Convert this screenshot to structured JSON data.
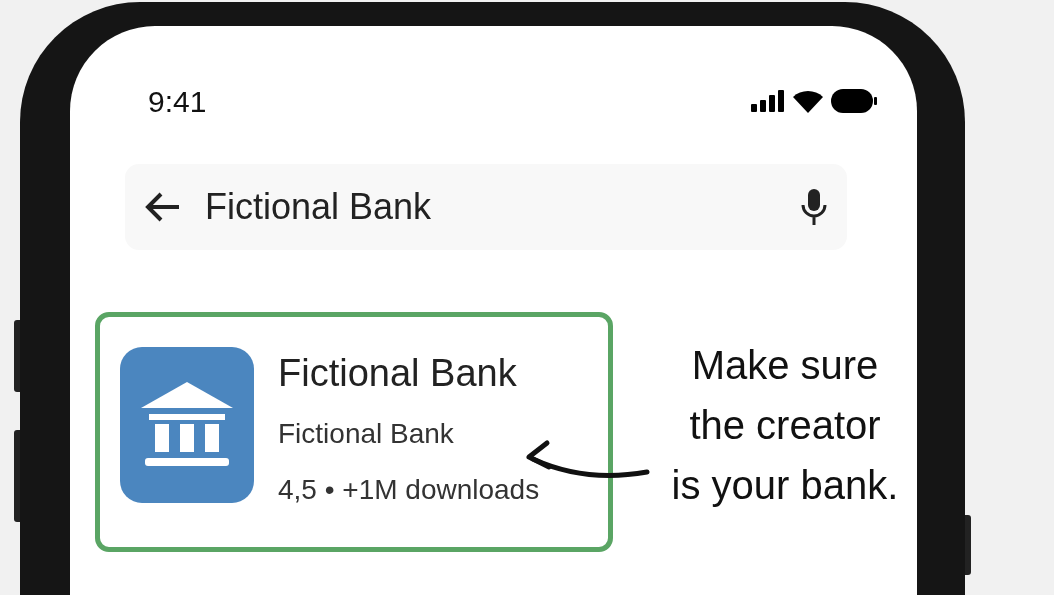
{
  "status_bar": {
    "time": "9:41"
  },
  "search": {
    "query": "Fictional Bank"
  },
  "result": {
    "title": "Fictional Bank",
    "developer": "Fictional Bank",
    "rating": "4,5",
    "separator": "•",
    "downloads": "+1M downloads",
    "highlighted": true
  },
  "annotation": {
    "lines": [
      "Make sure",
      "the creator",
      "is your bank."
    ]
  }
}
